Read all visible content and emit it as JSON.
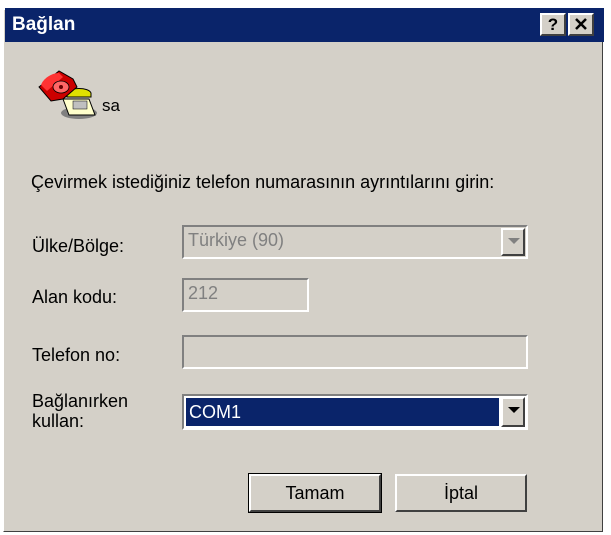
{
  "window": {
    "title": "Bağlan",
    "help_button": "?",
    "close_button": "✕"
  },
  "entry": {
    "icon": "phone-icon",
    "name": "sa"
  },
  "instructions": "Çevirmek istediğiniz telefon numarasının ayrıntılarını girin:",
  "fields": {
    "country_label": "Ülke/Bölge:",
    "country_value": "Türkiye (90)",
    "area_label": "Alan kodu:",
    "area_value": "212",
    "phone_label": "Telefon no:",
    "phone_value": "",
    "connect_label_line1": "Bağlanırken",
    "connect_label_line2": "kullan:",
    "connect_value": "COM1"
  },
  "buttons": {
    "ok": "Tamam",
    "cancel": "İptal"
  },
  "colors": {
    "titlebar": "#0a246a",
    "dialog_bg": "#d4d0c8",
    "selection": "#0a246a"
  }
}
